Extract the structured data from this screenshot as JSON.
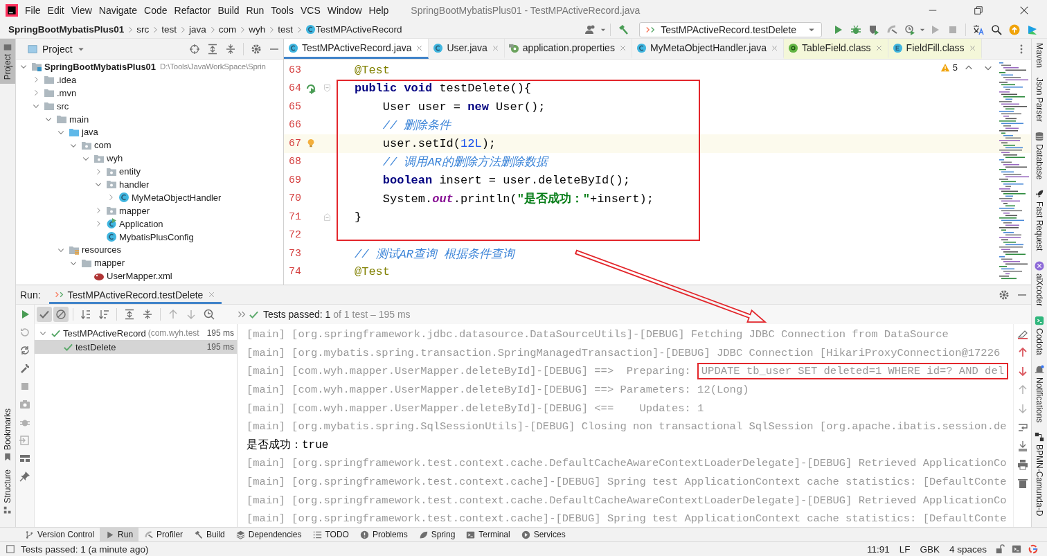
{
  "window": {
    "title": "SpringBootMybatisPlus01 - TestMPActiveRecord.java"
  },
  "menu": [
    "File",
    "Edit",
    "View",
    "Navigate",
    "Code",
    "Refactor",
    "Build",
    "Run",
    "Tools",
    "VCS",
    "Window",
    "Help"
  ],
  "breadcrumb": [
    {
      "label": "SpringBootMybatisPlus01",
      "kind": "project"
    },
    {
      "label": "src",
      "kind": "dir"
    },
    {
      "label": "test",
      "kind": "dir"
    },
    {
      "label": "java",
      "kind": "dir"
    },
    {
      "label": "com",
      "kind": "dir"
    },
    {
      "label": "wyh",
      "kind": "dir"
    },
    {
      "label": "test",
      "kind": "dir"
    },
    {
      "label": "TestMPActiveRecord",
      "kind": "class"
    }
  ],
  "run_config": "TestMPActiveRecord.testDelete",
  "left_stripe": [
    {
      "label": "Project",
      "selected": true
    },
    {
      "label": "Bookmarks",
      "selected": false
    },
    {
      "label": "Structure",
      "selected": false
    }
  ],
  "right_stripe": [
    {
      "label": "Maven",
      "kind": "plain"
    },
    {
      "label": "Json Parser",
      "kind": "plain"
    },
    {
      "label": "Database",
      "kind": "database"
    },
    {
      "label": "Fast Request",
      "kind": "rocket"
    },
    {
      "label": "aiXcoder",
      "kind": "ai"
    },
    {
      "label": "Codota",
      "kind": "codota"
    },
    {
      "label": "Notifications",
      "kind": "bell"
    },
    {
      "label": "BPMN-Camunda-D",
      "kind": "bpmn"
    }
  ],
  "project": {
    "title": "Project",
    "tree": [
      {
        "label": "SpringBootMybatisPlus01",
        "path": "D:\\Tools\\JavaWorkSpace\\Sprin",
        "kind": "module",
        "expanded": true,
        "children": [
          {
            "label": ".idea",
            "kind": "folder",
            "expanded": false
          },
          {
            "label": ".mvn",
            "kind": "folder",
            "expanded": false
          },
          {
            "label": "src",
            "kind": "folder",
            "expanded": true,
            "children": [
              {
                "label": "main",
                "kind": "folder",
                "expanded": true,
                "children": [
                  {
                    "label": "java",
                    "kind": "source",
                    "expanded": true,
                    "children": [
                      {
                        "label": "com",
                        "kind": "package",
                        "expanded": true,
                        "children": [
                          {
                            "label": "wyh",
                            "kind": "package",
                            "expanded": true,
                            "children": [
                              {
                                "label": "entity",
                                "kind": "package",
                                "expanded": false
                              },
                              {
                                "label": "handler",
                                "kind": "package",
                                "expanded": true,
                                "children": [
                                  {
                                    "label": "MyMetaObjectHandler",
                                    "kind": "class",
                                    "expanded": false
                                  }
                                ]
                              },
                              {
                                "label": "mapper",
                                "kind": "package",
                                "expanded": false
                              },
                              {
                                "label": "Application",
                                "kind": "app",
                                "expanded": false
                              },
                              {
                                "label": "MybatisPlusConfig",
                                "kind": "class"
                              }
                            ]
                          }
                        ]
                      }
                    ]
                  },
                  {
                    "label": "resources",
                    "kind": "resources",
                    "expanded": true,
                    "children": [
                      {
                        "label": "mapper",
                        "kind": "folder",
                        "expanded": true,
                        "children": [
                          {
                            "label": "UserMapper.xml",
                            "kind": "xml"
                          }
                        ]
                      }
                    ]
                  }
                ]
              }
            ]
          }
        ]
      }
    ]
  },
  "editor": {
    "tabs": [
      {
        "label": "TestMPActiveRecord.java",
        "kind": "class",
        "selected": true,
        "readonly": false
      },
      {
        "label": "User.java",
        "kind": "class",
        "selected": false,
        "readonly": false
      },
      {
        "label": "application.properties",
        "kind": "properties",
        "selected": false,
        "readonly": false
      },
      {
        "label": "MyMetaObjectHandler.java",
        "kind": "class",
        "selected": false,
        "readonly": false
      },
      {
        "label": "TableField.class",
        "kind": "annotation",
        "selected": false,
        "readonly": true
      },
      {
        "label": "FieldFill.class",
        "kind": "enum",
        "selected": false,
        "readonly": true
      }
    ],
    "warnings": "5",
    "lines": [
      {
        "number": "63",
        "kind": "plain",
        "current": false,
        "tokens": [
          {
            "kind": "annotation",
            "text": "@Test"
          }
        ]
      },
      {
        "number": "64",
        "kind": "method-start",
        "current": false,
        "tokens": [
          {
            "kind": "keyword",
            "text": "public void"
          },
          {
            "kind": "plain",
            "text": " testDelete(){"
          }
        ]
      },
      {
        "number": "65",
        "kind": "plain",
        "current": false,
        "tokens": [
          {
            "kind": "plain",
            "text": "    User user = "
          },
          {
            "kind": "keyword",
            "text": "new"
          },
          {
            "kind": "plain",
            "text": " User();"
          }
        ]
      },
      {
        "number": "66",
        "kind": "plain",
        "current": false,
        "tokens": [
          {
            "kind": "comment",
            "text": "    // 删除条件"
          }
        ]
      },
      {
        "number": "67",
        "kind": "plain",
        "current": true,
        "tokens": [
          {
            "kind": "plain",
            "text": "    user.setId("
          },
          {
            "kind": "number",
            "text": "12L"
          },
          {
            "kind": "plain",
            "text": ");"
          }
        ]
      },
      {
        "number": "68",
        "kind": "plain",
        "current": false,
        "tokens": [
          {
            "kind": "comment",
            "text": "    // 调用AR的删除方法删除数据"
          }
        ]
      },
      {
        "number": "69",
        "kind": "plain",
        "current": false,
        "tokens": [
          {
            "kind": "keyword",
            "text": "    boolean"
          },
          {
            "kind": "plain",
            "text": " insert = user.deleteById();"
          }
        ]
      },
      {
        "number": "70",
        "kind": "plain",
        "current": false,
        "tokens": [
          {
            "kind": "plain",
            "text": "    System."
          },
          {
            "kind": "field",
            "text": "out"
          },
          {
            "kind": "plain",
            "text": ".println("
          },
          {
            "kind": "string",
            "text": "\"是否成功：\""
          },
          {
            "kind": "plain",
            "text": "+insert);"
          }
        ]
      },
      {
        "number": "71",
        "kind": "method-end",
        "current": false,
        "tokens": [
          {
            "kind": "plain",
            "text": "}"
          }
        ]
      },
      {
        "number": "72",
        "kind": "plain",
        "current": false
      },
      {
        "number": "73",
        "kind": "plain",
        "current": false,
        "tokens": [
          {
            "kind": "comment",
            "text": "// 测试AR查询 根据条件查询"
          }
        ]
      },
      {
        "number": "74",
        "kind": "plain",
        "current": false,
        "tokens": [
          {
            "kind": "annotation",
            "text": "@Test"
          }
        ]
      }
    ]
  },
  "run": {
    "label": "Run:",
    "tab": "TestMPActiveRecord.testDelete",
    "filters": [
      {
        "kind": "passed",
        "selected": true
      },
      {
        "kind": "ignored",
        "selected": true
      }
    ],
    "summary": "Tests passed: 1",
    "summary_detail": "of 1 test – 195 ms",
    "tests": [
      {
        "label": "TestMPActiveRecord",
        "detail": "(com.wyh.test",
        "time": "195 ms",
        "passed": true,
        "selected": false,
        "expanded": true,
        "children": [
          {
            "label": "testDelete",
            "time": "195 ms",
            "passed": true,
            "selected": true
          }
        ]
      }
    ],
    "console": [
      {
        "kind": "log",
        "text": "[main] [org.springframework.jdbc.datasource.DataSourceUtils]-[DEBUG] Fetching JDBC Connection from DataSource"
      },
      {
        "kind": "log",
        "text": "[main] [org.mybatis.spring.transaction.SpringManagedTransaction]-[DEBUG] JDBC Connection [HikariProxyConnection@17226"
      },
      {
        "kind": "log",
        "text": "[main] [com.wyh.mapper.UserMapper.deleteById]-[DEBUG] ==>  Preparing:",
        "boxed_text": "UPDATE tb_user SET deleted=1 WHERE id=? AND del"
      },
      {
        "kind": "log",
        "text": "[main] [com.wyh.mapper.UserMapper.deleteById]-[DEBUG] ==> Parameters: 12(Long)"
      },
      {
        "kind": "log",
        "text": "[main] [com.wyh.mapper.UserMapper.deleteById]-[DEBUG] <==    Updates: 1"
      },
      {
        "kind": "log",
        "text": "[main] [org.mybatis.spring.SqlSessionUtils]-[DEBUG] Closing non transactional SqlSession [org.apache.ibatis.session.de"
      },
      {
        "kind": "output",
        "text": "是否成功：true"
      },
      {
        "kind": "log",
        "text": "[main] [org.springframework.test.context.cache.DefaultCacheAwareContextLoaderDelegate]-[DEBUG] Retrieved ApplicationCo"
      },
      {
        "kind": "log",
        "text": "[main] [org.springframework.test.context.cache]-[DEBUG] Spring test ApplicationContext cache statistics: [DefaultConte"
      },
      {
        "kind": "log",
        "text": "[main] [org.springframework.test.context.cache.DefaultCacheAwareContextLoaderDelegate]-[DEBUG] Retrieved ApplicationCo"
      },
      {
        "kind": "log",
        "text": "[main] [org.springframework.test.context.cache]-[DEBUG] Spring test ApplicationContext cache statistics: [DefaultConte"
      }
    ]
  },
  "tool_tabs": [
    {
      "label": "Version Control",
      "kind": "branch",
      "selected": false
    },
    {
      "label": "Run",
      "kind": "play",
      "selected": true
    },
    {
      "label": "Profiler",
      "kind": "profiler",
      "selected": false
    },
    {
      "label": "Build",
      "kind": "hammer",
      "selected": false
    },
    {
      "label": "Dependencies",
      "kind": "layers",
      "selected": false
    },
    {
      "label": "TODO",
      "kind": "list",
      "selected": false
    },
    {
      "label": "Problems",
      "kind": "problem",
      "selected": false
    },
    {
      "label": "Spring",
      "kind": "leaf",
      "selected": false
    },
    {
      "label": "Terminal",
      "kind": "terminal",
      "selected": false
    },
    {
      "label": "Services",
      "kind": "services",
      "selected": false
    }
  ],
  "status_bar": {
    "message": "Tests passed: 1 (a minute ago)",
    "items": [
      "11:91",
      "LF",
      "GBK",
      "4 spaces"
    ]
  },
  "annotations": {
    "color": "#e3262b"
  }
}
